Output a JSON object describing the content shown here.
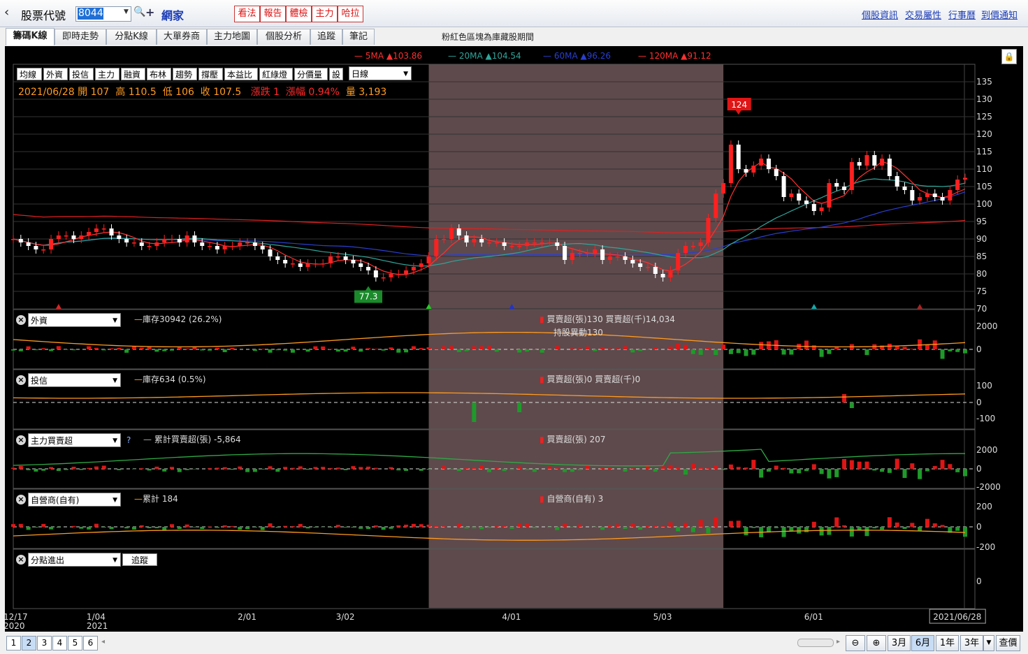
{
  "header": {
    "back_icon": "‹",
    "stock_label": "股票代號",
    "stock_code": "8044",
    "stock_name": "網家",
    "red_buttons": [
      "看法",
      "報告",
      "體檢",
      "主力",
      "哈拉"
    ],
    "links": [
      "個股資訊",
      "交易屬性",
      "行事曆",
      "到價通知"
    ]
  },
  "tabs": [
    "籌碼K線",
    "即時走勢",
    "分點K線",
    "大單券商",
    "主力地圖",
    "個股分析",
    "追蹤",
    "筆記"
  ],
  "note": "粉紅色區塊為庫藏股期間",
  "toolbar": {
    "buttons": [
      "均線",
      "外資",
      "投信",
      "主力",
      "融資",
      "布林",
      "趨勢",
      "撐壓",
      "本益比",
      "紅綠燈",
      "分價量",
      "設"
    ],
    "period": "日線"
  },
  "info": {
    "date": "2021/06/28",
    "open_label": "開",
    "open": "107",
    "high_label": "高",
    "high": "110.5",
    "low_label": "低",
    "low": "106",
    "close_label": "收",
    "close": "107.5",
    "change": "漲跌 1",
    "pct": "漲幅 0.94%",
    "volume": "量 3,193"
  },
  "ma_legend": [
    "5MA ▲103.86",
    "20MA ▲104.54",
    "60MA ▲96.26",
    "120MA ▲91.12"
  ],
  "panels": {
    "foreign": {
      "select": "外資",
      "legend": "庫存30942 (26.2%)",
      "info1": "買賣超(張)130 買賣超(千)14,034",
      "info2": "持股異動130"
    },
    "trust": {
      "select": "投信",
      "legend": "庫存634 (0.5%)",
      "info1": "買賣超(張)0 買賣超(千)0"
    },
    "major": {
      "select": "主力買賣超",
      "help": "?",
      "legend": "累計買賣超(張) -5,864",
      "info1": "買賣超(張) 207"
    },
    "dealer": {
      "select": "自營商(自有)",
      "legend": "累計 184",
      "info1": "自營商(自有) 3"
    },
    "branch": {
      "select": "分點進出",
      "button": "追蹤"
    }
  },
  "bottom": {
    "pages": [
      "1",
      "2",
      "3",
      "4",
      "5",
      "6"
    ],
    "zoom_buttons": [
      "3月",
      "6月",
      "1年",
      "3年"
    ],
    "query": "查價"
  },
  "chart_data": {
    "type": "candlestick",
    "price_axis": {
      "ticks": [
        70,
        75,
        80,
        85,
        90,
        95,
        100,
        105,
        110,
        115,
        120,
        125,
        130,
        135
      ],
      "range": [
        70,
        140
      ]
    },
    "x_labels": [
      {
        "label": "12/17",
        "sub": "2020",
        "index": 0
      },
      {
        "label": "1/04",
        "sub": "2021",
        "index": 11
      },
      {
        "label": "2/01",
        "sub": "",
        "index": 31
      },
      {
        "label": "3/02",
        "sub": "",
        "index": 44
      },
      {
        "label": "4/01",
        "sub": "",
        "index": 66
      },
      {
        "label": "5/03",
        "sub": "",
        "index": 86
      },
      {
        "label": "6/01",
        "sub": "",
        "index": 106
      },
      {
        "label": "2021/06/28",
        "sub": "",
        "index": 125
      }
    ],
    "buyback_period_index": [
      55,
      94
    ],
    "annotations": {
      "high_label": "124",
      "high_index": 96,
      "low_label": "77.3",
      "low_index": 47
    },
    "closes": [
      90,
      89,
      88,
      87,
      87,
      90,
      91,
      91,
      90,
      91,
      92,
      93,
      93,
      91,
      90,
      89,
      89,
      88,
      88,
      89,
      90,
      90,
      89,
      91,
      89,
      88,
      88,
      87,
      88,
      88,
      89,
      89,
      88,
      87,
      85,
      84,
      83,
      83,
      82,
      83,
      83,
      83,
      85,
      85,
      84,
      83,
      82,
      81,
      79,
      79,
      80,
      80,
      81,
      82,
      83,
      85,
      90,
      90,
      93,
      91,
      89,
      90,
      89,
      89,
      89,
      88,
      88,
      88,
      89,
      89,
      89,
      89,
      88,
      84,
      86,
      86,
      86,
      87,
      84,
      85,
      85,
      84,
      83,
      82,
      82,
      80,
      79,
      81,
      86,
      88,
      88,
      89,
      96,
      103,
      106,
      117,
      110,
      109,
      111,
      113,
      110,
      108,
      102,
      103,
      101,
      100,
      98,
      99,
      106,
      105,
      104,
      112,
      111,
      114,
      111,
      113,
      108,
      105,
      104,
      101,
      102,
      103,
      102,
      101,
      104,
      107,
      107.5
    ],
    "volumes_note": "candles drawn from closes",
    "ma_series": [
      {
        "name": "5MA",
        "color": "#ff3030"
      },
      {
        "name": "20MA",
        "color": "#2fa59a"
      },
      {
        "name": "60MA",
        "color": "#2a3fd0"
      },
      {
        "name": "120MA",
        "color": "#e02020"
      }
    ],
    "foreign_axis": {
      "ticks": [
        "2000",
        "0"
      ]
    },
    "trust_axis": {
      "ticks": [
        "100",
        "0",
        "-100"
      ]
    },
    "major_axis": {
      "ticks": [
        "2000",
        "0",
        "-2000"
      ]
    },
    "dealer_axis": {
      "ticks": [
        "200",
        "0",
        "-200"
      ]
    },
    "branch_axis": {
      "ticks": [
        "0"
      ]
    }
  }
}
